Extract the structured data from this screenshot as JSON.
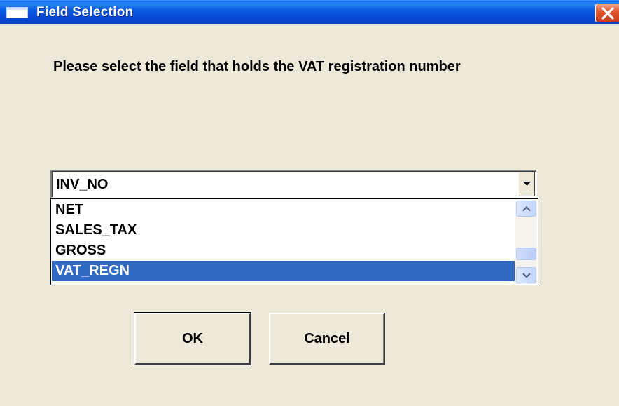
{
  "window": {
    "title": "Field Selection",
    "icon": "window-icon",
    "close_icon": "close-icon"
  },
  "prompt": "Please select the field that holds the VAT registration number",
  "combo": {
    "selected_value": "INV_NO",
    "arrow_icon": "chevron-down-icon"
  },
  "dropdown": {
    "options": [
      "NET",
      "SALES_TAX",
      "GROSS",
      "VAT_REGN"
    ],
    "highlighted": "VAT_REGN"
  },
  "buttons": {
    "ok_label": "OK",
    "cancel_label": "Cancel"
  },
  "colors": {
    "titlebar": "#0A5AE0",
    "selection": "#316AC5",
    "dialog_bg": "#ECE9D8",
    "close": "#E0552C"
  }
}
